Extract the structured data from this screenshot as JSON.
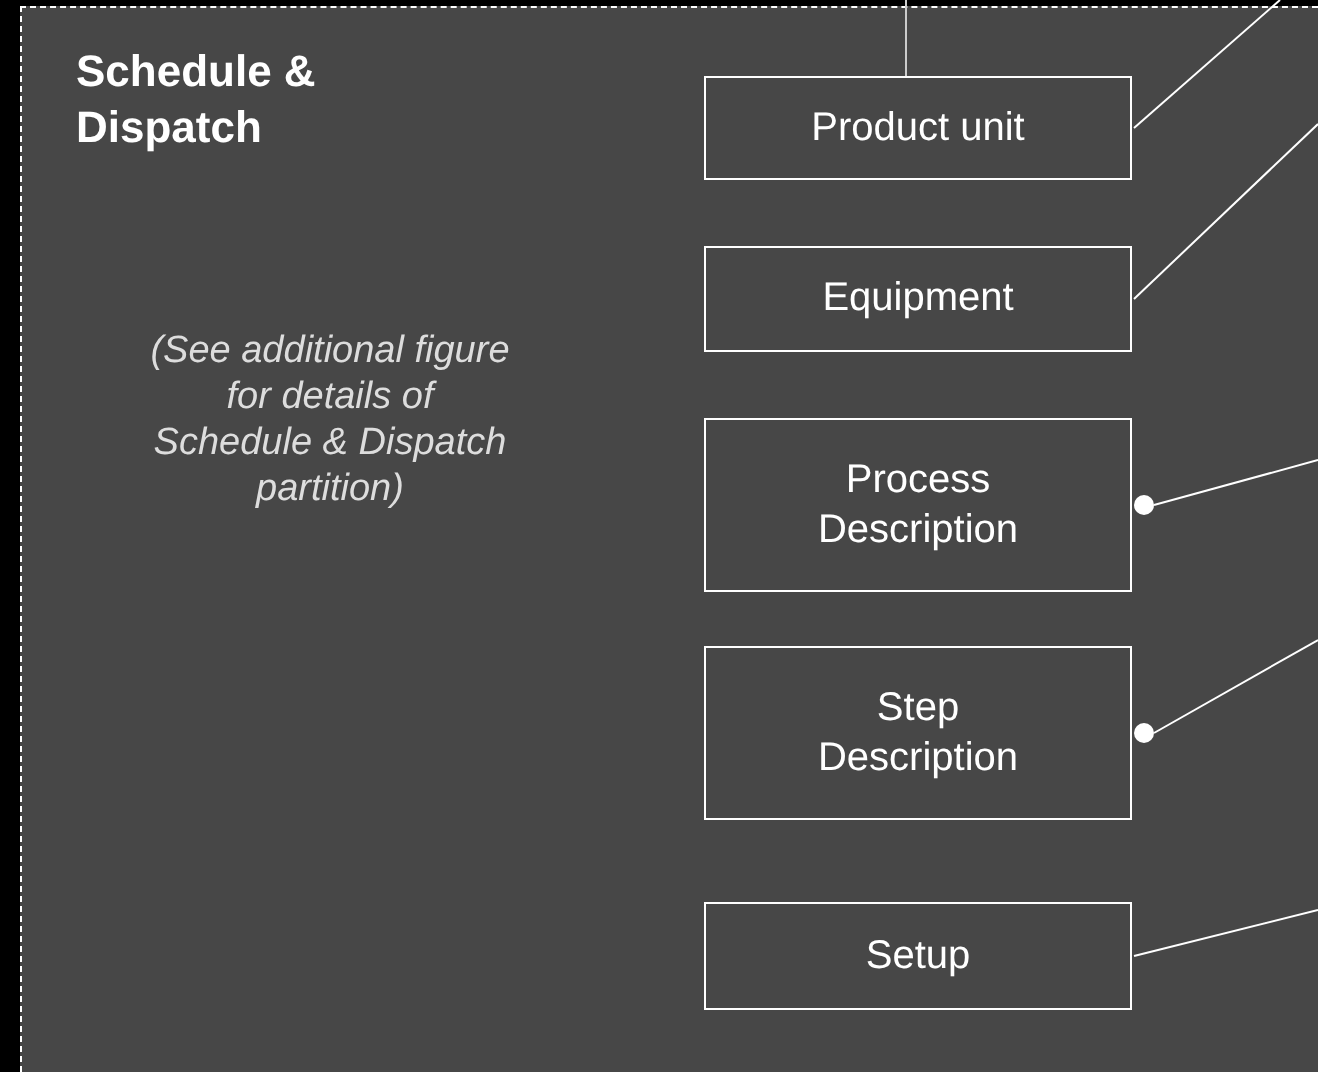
{
  "partition": {
    "title": "Schedule & Dispatch",
    "note": "(See additional figure for details of Schedule & Dispatch partition)"
  },
  "nodes": [
    {
      "label": "Product unit",
      "kind": "plain"
    },
    {
      "label": "Equipment",
      "kind": "plain"
    },
    {
      "label": "Process Description",
      "kind": "dot"
    },
    {
      "label": "Step Description",
      "kind": "dot"
    },
    {
      "label": "Setup",
      "kind": "plain"
    }
  ]
}
